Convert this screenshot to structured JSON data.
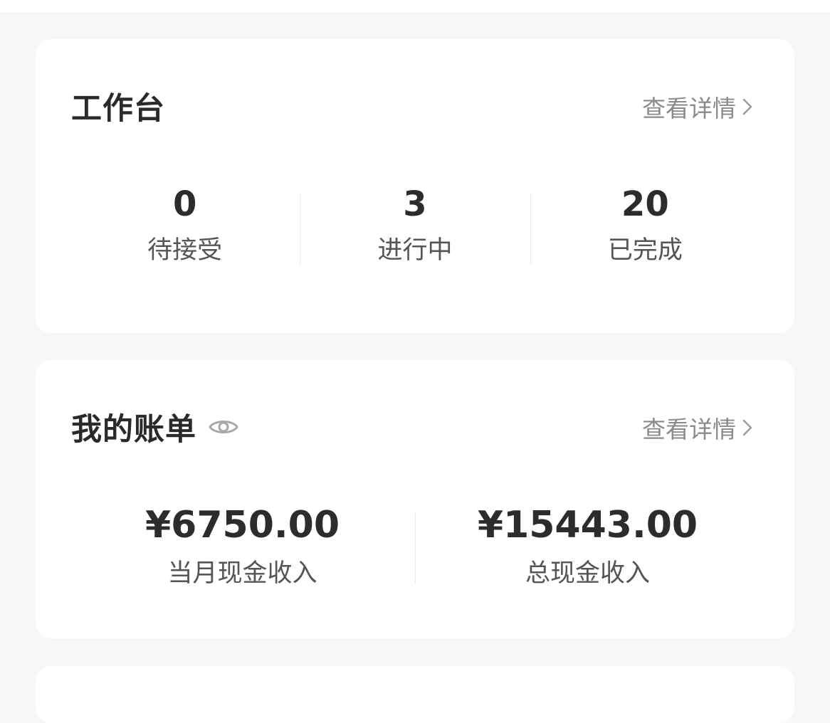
{
  "workbench": {
    "title": "工作台",
    "detail_link": "查看详情",
    "stats": [
      {
        "value": "0",
        "label": "待接受"
      },
      {
        "value": "3",
        "label": "进行中"
      },
      {
        "value": "20",
        "label": "已完成"
      }
    ]
  },
  "bill": {
    "title": "我的账单",
    "detail_link": "查看详情",
    "stats": [
      {
        "value": "¥6750.00",
        "label": "当月现金收入"
      },
      {
        "value": "¥15443.00",
        "label": "总现金收入"
      }
    ]
  },
  "icons": {
    "eye": "eye-icon",
    "chevron": "chevron-right-icon"
  },
  "colors": {
    "background": "#f7f7f7",
    "card": "#ffffff",
    "title": "#2a2a2a",
    "muted": "#8a8a8a",
    "value": "#2c2c2c",
    "label": "#555555"
  }
}
